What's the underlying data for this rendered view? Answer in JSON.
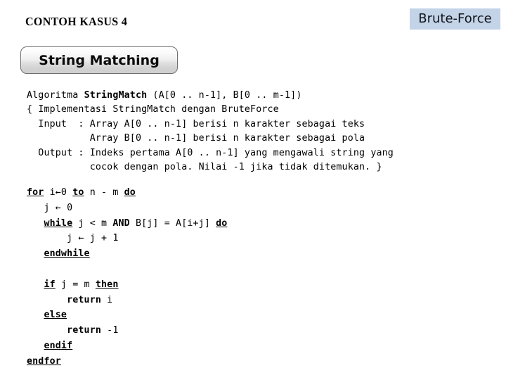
{
  "page_title": "CONTOH KASUS 4",
  "badge": {
    "label": "Brute-Force",
    "background_color": "#c3d3e8",
    "text_color": "#111318"
  },
  "button": {
    "label": "String Matching",
    "border_color": "#6f6f6f",
    "gradient_top": "#ffffff",
    "gradient_bottom": "#cfcfcf"
  },
  "pseudocode": {
    "header_lines": [
      {
        "id": "line-algoritma",
        "segments": [
          {
            "text": "Algoritma ",
            "bold": false
          },
          {
            "text": "StringMatch",
            "bold": true
          },
          {
            "text": " (A[0 .. n-1], B[0 .. m-1])",
            "bold": false
          }
        ]
      },
      {
        "id": "line-implementasi",
        "segments": [
          {
            "text": "{ Implementasi StringMatch dengan BruteForce",
            "bold": false
          }
        ]
      },
      {
        "id": "line-input",
        "segments": [
          {
            "text": "  Input  : Array A[0 .. n-1] berisi n karakter sebagai teks",
            "bold": false
          }
        ]
      },
      {
        "id": "line-input-cont",
        "segments": [
          {
            "text": "           Array B[0 .. n-1] berisi n karakter sebagai pola",
            "bold": false
          }
        ]
      },
      {
        "id": "line-output",
        "segments": [
          {
            "text": "  Output : Indeks pertama A[0 .. n-1] yang mengawali string yang",
            "bold": false
          }
        ]
      },
      {
        "id": "line-output-cont",
        "segments": [
          {
            "text": "           cocok dengan pola. Nilai -1 jika tidak ditemukan. }",
            "bold": false
          }
        ]
      }
    ],
    "body_lines": [
      {
        "id": "line-for",
        "segments": [
          {
            "text": "",
            "style": "plain"
          },
          {
            "text": "for",
            "style": "keyword"
          },
          {
            "text": " i←0 ",
            "style": "plain"
          },
          {
            "text": "to",
            "style": "keyword"
          },
          {
            "text": " n - m ",
            "style": "plain"
          },
          {
            "text": "do",
            "style": "keyword"
          }
        ]
      },
      {
        "id": "line-j-init",
        "segments": [
          {
            "text": "   j ← 0",
            "style": "plain"
          }
        ]
      },
      {
        "id": "line-while",
        "segments": [
          {
            "text": "   ",
            "style": "plain"
          },
          {
            "text": "while",
            "style": "keyword"
          },
          {
            "text": " j < m ",
            "style": "plain"
          },
          {
            "text": "AND",
            "style": "bold"
          },
          {
            "text": " B[j] = A[i+j] ",
            "style": "plain"
          },
          {
            "text": "do",
            "style": "keyword"
          }
        ]
      },
      {
        "id": "line-j-incr",
        "segments": [
          {
            "text": "       j ← j + 1",
            "style": "plain"
          }
        ]
      },
      {
        "id": "line-endwhile",
        "segments": [
          {
            "text": "   ",
            "style": "plain"
          },
          {
            "text": "endwhile",
            "style": "keyword"
          }
        ]
      },
      {
        "id": "line-blank",
        "segments": [
          {
            "text": " ",
            "style": "plain"
          }
        ]
      },
      {
        "id": "line-if",
        "segments": [
          {
            "text": "   ",
            "style": "plain"
          },
          {
            "text": "if",
            "style": "keyword"
          },
          {
            "text": " j = m ",
            "style": "plain"
          },
          {
            "text": "then",
            "style": "keyword"
          }
        ]
      },
      {
        "id": "line-return-i",
        "segments": [
          {
            "text": "       ",
            "style": "plain"
          },
          {
            "text": "return",
            "style": "bold"
          },
          {
            "text": " i",
            "style": "plain"
          }
        ]
      },
      {
        "id": "line-else",
        "segments": [
          {
            "text": "   ",
            "style": "plain"
          },
          {
            "text": "else",
            "style": "keyword"
          }
        ]
      },
      {
        "id": "line-return-neg1",
        "segments": [
          {
            "text": "       ",
            "style": "plain"
          },
          {
            "text": "return",
            "style": "bold"
          },
          {
            "text": " -1",
            "style": "plain"
          }
        ]
      },
      {
        "id": "line-endif",
        "segments": [
          {
            "text": "   ",
            "style": "plain"
          },
          {
            "text": "endif",
            "style": "keyword"
          }
        ]
      },
      {
        "id": "line-endfor",
        "segments": [
          {
            "text": "",
            "style": "plain"
          },
          {
            "text": "endfor",
            "style": "keyword"
          }
        ]
      }
    ]
  }
}
